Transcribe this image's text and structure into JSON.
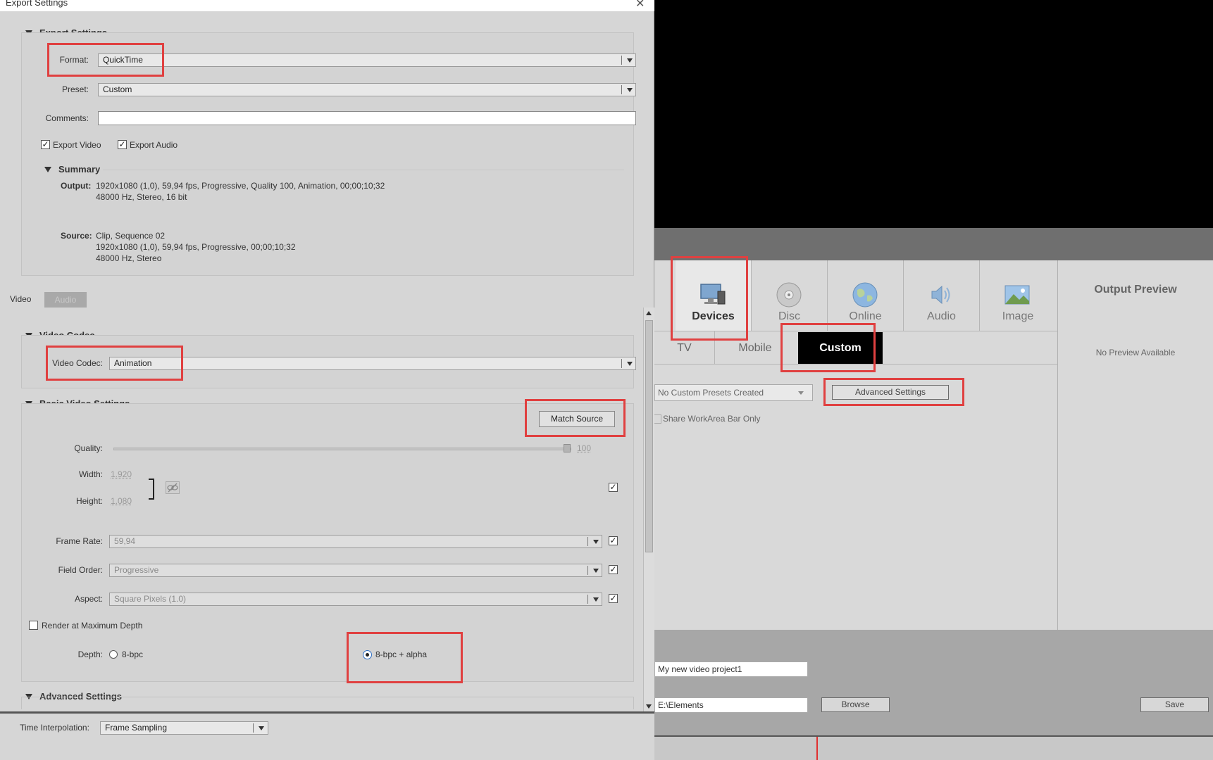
{
  "dialog": {
    "title": "Export Settings",
    "close_icon": "close-icon",
    "export_settings": {
      "heading": "Export Settings",
      "format_label": "Format:",
      "format_value": "QuickTime",
      "preset_label": "Preset:",
      "preset_value": "Custom",
      "comments_label": "Comments:",
      "comments_value": "",
      "export_video_label": "Export Video",
      "export_video_checked": true,
      "export_audio_label": "Export Audio",
      "export_audio_checked": true,
      "summary": {
        "heading": "Summary",
        "output_label": "Output:",
        "output_line1": "1920x1080 (1,0), 59,94 fps, Progressive, Quality 100, Animation, 00;00;10;32",
        "output_line2": "48000 Hz, Stereo, 16 bit",
        "source_label": "Source:",
        "source_line1": "Clip, Sequence 02",
        "source_line2": "1920x1080 (1,0), 59,94 fps, Progressive, 00;00;10;32",
        "source_line3": "48000 Hz, Stereo"
      }
    },
    "tabs": [
      {
        "label": "Video",
        "active": true
      },
      {
        "label": "Audio",
        "active": false
      }
    ],
    "video_codec": {
      "heading": "Video Codec",
      "label": "Video Codec:",
      "value": "Animation"
    },
    "basic_video": {
      "heading": "Basic Video Settings",
      "match_source": "Match Source",
      "quality_label": "Quality:",
      "quality_value": "100",
      "quality_fraction": 1.0,
      "width_label": "Width:",
      "width_value": "1.920",
      "height_label": "Height:",
      "height_value": "1.080",
      "frame_rate_label": "Frame Rate:",
      "frame_rate_value": "59,94",
      "field_order_label": "Field Order:",
      "field_order_value": "Progressive",
      "aspect_label": "Aspect:",
      "aspect_value": "Square Pixels (1.0)",
      "render_max_depth_label": "Render at Maximum Depth",
      "depth_label": "Depth:",
      "depth_option1": "8-bpc",
      "depth_option2": "8-bpc + alpha",
      "depth_selected": "8-bpc + alpha"
    },
    "advanced": {
      "heading": "Advanced Settings"
    },
    "footer": {
      "time_interp_label": "Time Interpolation:",
      "time_interp_value": "Frame Sampling"
    }
  },
  "app": {
    "categories": [
      {
        "label": "Devices",
        "icon": "monitor-icon",
        "active": true
      },
      {
        "label": "Disc",
        "icon": "disc-icon",
        "active": false
      },
      {
        "label": "Online",
        "icon": "globe-icon",
        "active": false
      },
      {
        "label": "Audio",
        "icon": "speaker-icon",
        "active": false
      },
      {
        "label": "Image",
        "icon": "image-icon",
        "active": false
      }
    ],
    "sub_tabs": [
      {
        "label": "TV",
        "active": false
      },
      {
        "label": "Mobile",
        "active": false
      },
      {
        "label": "Custom",
        "active": true
      }
    ],
    "presets_dropdown": "No Custom Presets Created",
    "advanced_settings_button": "Advanced Settings",
    "share_workarea_label": "Share WorkArea Bar Only",
    "output_preview_title": "Output Preview",
    "no_preview": "No Preview Available",
    "file_name": "My new video project1",
    "save_path": "E:\\Elements",
    "browse_button": "Browse",
    "save_button": "Save"
  },
  "colors": {
    "highlight": "#e04040",
    "custom_tab_bg": "#000000",
    "radio_selected": "#2a6cc4"
  }
}
